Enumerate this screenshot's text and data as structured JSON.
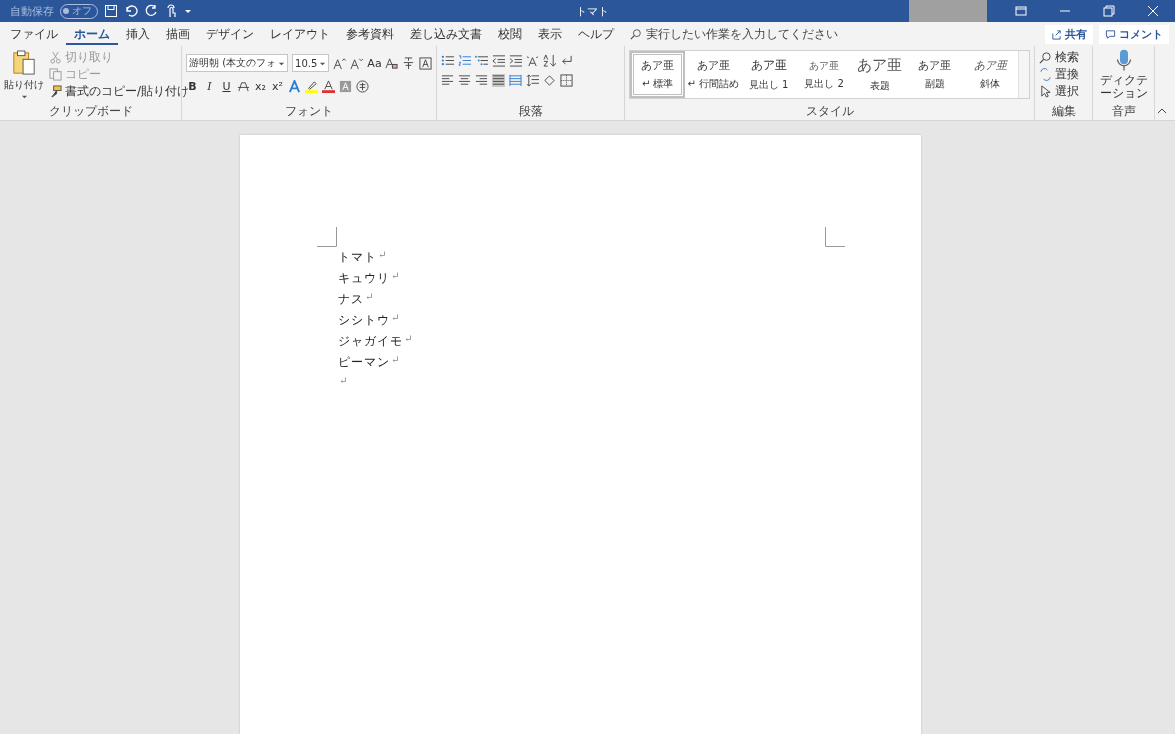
{
  "title_bar": {
    "autosave_label": "自動保存",
    "autosave_toggle": {
      "label": "オフ",
      "on": false
    },
    "title": "トマト"
  },
  "tabs": [
    {
      "label": "ファイル",
      "selected": false
    },
    {
      "label": "ホーム",
      "selected": true
    },
    {
      "label": "挿入",
      "selected": false
    },
    {
      "label": "描画",
      "selected": false
    },
    {
      "label": "デザイン",
      "selected": false
    },
    {
      "label": "レイアウト",
      "selected": false
    },
    {
      "label": "参考資料",
      "selected": false
    },
    {
      "label": "差し込み文書",
      "selected": false
    },
    {
      "label": "校閲",
      "selected": false
    },
    {
      "label": "表示",
      "selected": false
    },
    {
      "label": "ヘルプ",
      "selected": false
    }
  ],
  "tell_me": {
    "placeholder": "実行したい作業を入力してください"
  },
  "share_button": "共有",
  "comment_button": "コメント",
  "clipboard": {
    "label": "クリップボード",
    "paste": "貼り付け",
    "cut": {
      "label": "切り取り",
      "disabled": true
    },
    "copy": {
      "label": "コピー",
      "disabled": true
    },
    "format_painter": {
      "label": "書式のコピー/貼り付け",
      "disabled": false
    }
  },
  "font": {
    "label": "フォント",
    "font_name": "游明朝 (本文のフォ",
    "font_size": "10.5",
    "change_case": "Aa",
    "bold": "B",
    "italic": "I",
    "underline": "U",
    "subscript": "x₂",
    "superscript": "x²"
  },
  "paragraph": {
    "label": "段落"
  },
  "styles": {
    "label": "スタイル",
    "items": [
      {
        "sample": "あア亜",
        "name": "↵ 標準",
        "selected": true
      },
      {
        "sample": "あア亜",
        "name": "↵ 行間詰め",
        "selected": false
      },
      {
        "sample": "あア亜",
        "name": "見出し 1",
        "selected": false
      },
      {
        "sample": "あア亜",
        "name": "見出し 2",
        "selected": false
      },
      {
        "sample": "あア亜",
        "name": "表題",
        "selected": false
      },
      {
        "sample": "あア亜",
        "name": "副題",
        "selected": false
      },
      {
        "sample": "あア亜",
        "name": "斜体",
        "selected": false
      }
    ]
  },
  "editing": {
    "label": "編集",
    "find": "検索",
    "replace": "置換",
    "select": "選択"
  },
  "voice": {
    "label": "音声",
    "dictate": "ディクテーション"
  },
  "document": {
    "paragraphs": [
      {
        "text": "トマト",
        "mark": "↵"
      },
      {
        "text": "キュウリ",
        "mark": "↵"
      },
      {
        "text": "ナス",
        "mark": "↵"
      },
      {
        "text": "シシトウ",
        "mark": "↵"
      },
      {
        "text": "ジャガイモ",
        "mark": "↵"
      },
      {
        "text": "ピーマン",
        "mark": "↵"
      },
      {
        "mark": "↵"
      }
    ]
  }
}
